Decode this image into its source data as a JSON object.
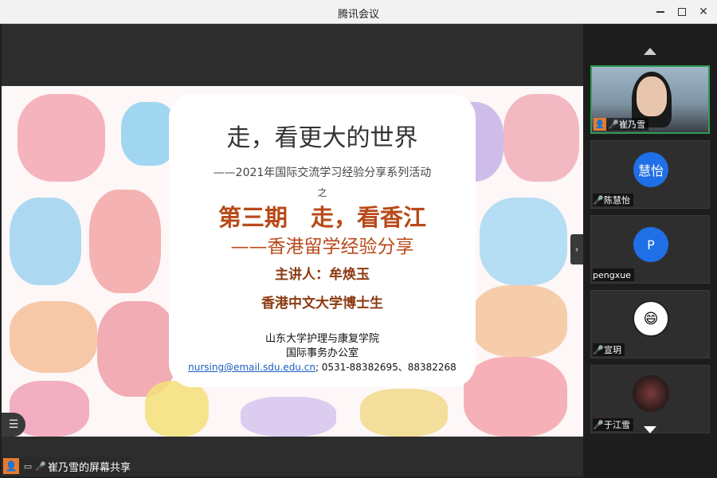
{
  "window": {
    "title": "腾讯会议"
  },
  "slide": {
    "title": "走，看更大的世界",
    "subtitle": "——2021年国际交流学习经验分享系列活动",
    "zhi": "之",
    "issue": "第三期　走，看香江",
    "issue_sub": "——香港留学经验分享",
    "speaker": "主讲人：牟焕玉",
    "degree": "香港中文大学博士生",
    "org_line1": "山东大学护理与康复学院",
    "org_line2": "国际事务办公室",
    "email": "nursing@email.sdu.edu.cn",
    "phone": "; 0531-88382695、88382268"
  },
  "share_label": {
    "text": "崔乃雪的屏幕共享"
  },
  "participants": [
    {
      "name": "崔乃雪",
      "avatar_type": "video",
      "mic": "on",
      "host": true
    },
    {
      "name": "陈慧怡",
      "avatar_text": "慧怡",
      "avatar_type": "initials",
      "mic": "muted"
    },
    {
      "name": "pengxue",
      "avatar_text": "P",
      "avatar_type": "initials",
      "mic": "none"
    },
    {
      "name": "宣玥",
      "avatar_type": "cartoon",
      "mic": "muted"
    },
    {
      "name": "于江雪",
      "avatar_type": "photo",
      "mic": "muted"
    }
  ],
  "colors": {
    "accent_green": "#2f9a59",
    "avatar_blue": "#1f6fe6",
    "host_orange": "#e87a2e",
    "slide_heading": "#b84a1a"
  }
}
